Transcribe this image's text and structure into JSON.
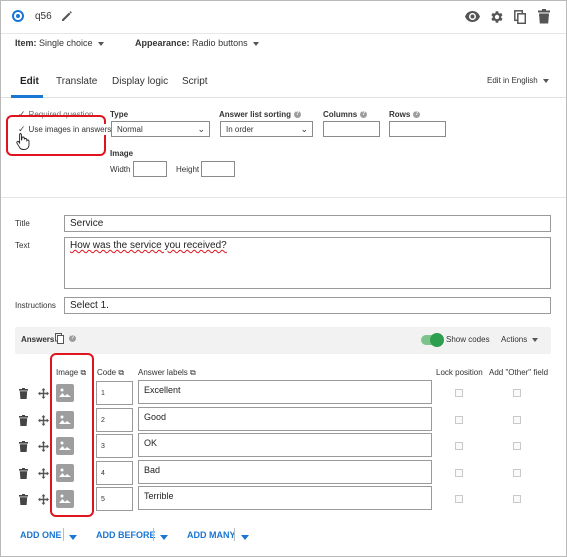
{
  "header": {
    "question_name": "q56"
  },
  "options_row": {
    "item_label": "Item:",
    "item_value": "Single choice",
    "appearance_label": "Appearance:",
    "appearance_value": "Radio buttons"
  },
  "tabs": [
    "Edit",
    "Translate",
    "Display logic",
    "Script"
  ],
  "edit_language": "Edit in English",
  "settings": {
    "required_question": "Required question",
    "use_images": "Use images in answers",
    "type_label": "Type",
    "type_value": "Normal",
    "sorting_label": "Answer list sorting",
    "sorting_value": "In order",
    "columns_label": "Columns",
    "rows_label": "Rows",
    "image_label": "Image",
    "width_label": "Width",
    "height_label": "Height"
  },
  "question": {
    "title_label": "Title",
    "title_value": "Service",
    "text_label": "Text",
    "text_value": "How was the service you received?",
    "instructions_label": "Instructions",
    "instructions_value": "Select 1."
  },
  "answers_bar": {
    "label": "Answers",
    "show_codes": "Show codes",
    "actions": "Actions"
  },
  "columns": {
    "image": "Image",
    "code": "Code",
    "labels": "Answer labels",
    "lock": "Lock position",
    "other": "Add \"Other\" field"
  },
  "answers": [
    {
      "code": "1",
      "label": "Excellent"
    },
    {
      "code": "2",
      "label": "Good"
    },
    {
      "code": "3",
      "label": "OK"
    },
    {
      "code": "4",
      "label": "Bad"
    },
    {
      "code": "5",
      "label": "Terrible"
    }
  ],
  "footer": {
    "add_one": "ADD ONE",
    "add_before": "ADD BEFORE",
    "add_many": "ADD MANY"
  },
  "colors": {
    "accent": "#1976d2",
    "highlight": "#e0141e",
    "toggle": "#2e9e4f"
  }
}
